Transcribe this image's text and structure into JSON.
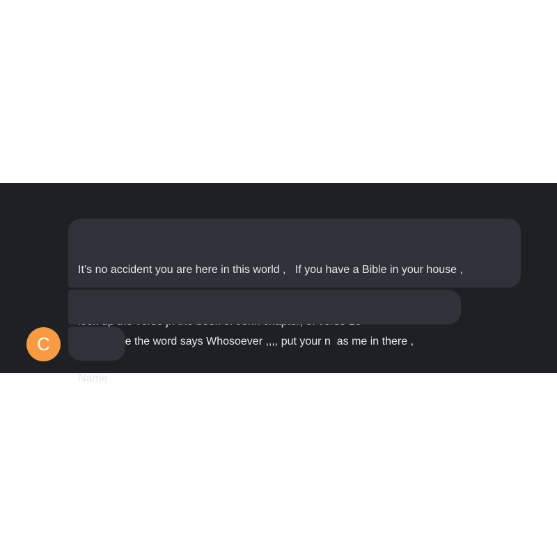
{
  "conversation": {
    "messages": [
      {
        "lines": [
          "It’s no accident you are here in this world ,   If you have a Bible in your house ,",
          "look up the verse jn the book of John chapter, 3: verse 16"
        ]
      },
      {
        "lines": [
          "And where the word says Whosoever ,,,, put your n  as me in there ,"
        ]
      },
      {
        "lines": [
          "Name"
        ]
      }
    ],
    "sender": {
      "avatar_initial": "C",
      "avatar_color": "#f79a42"
    }
  },
  "theme": {
    "panel_background": "#1f2024",
    "bubble_background": "#303239",
    "text_color": "#e6e7ea"
  }
}
